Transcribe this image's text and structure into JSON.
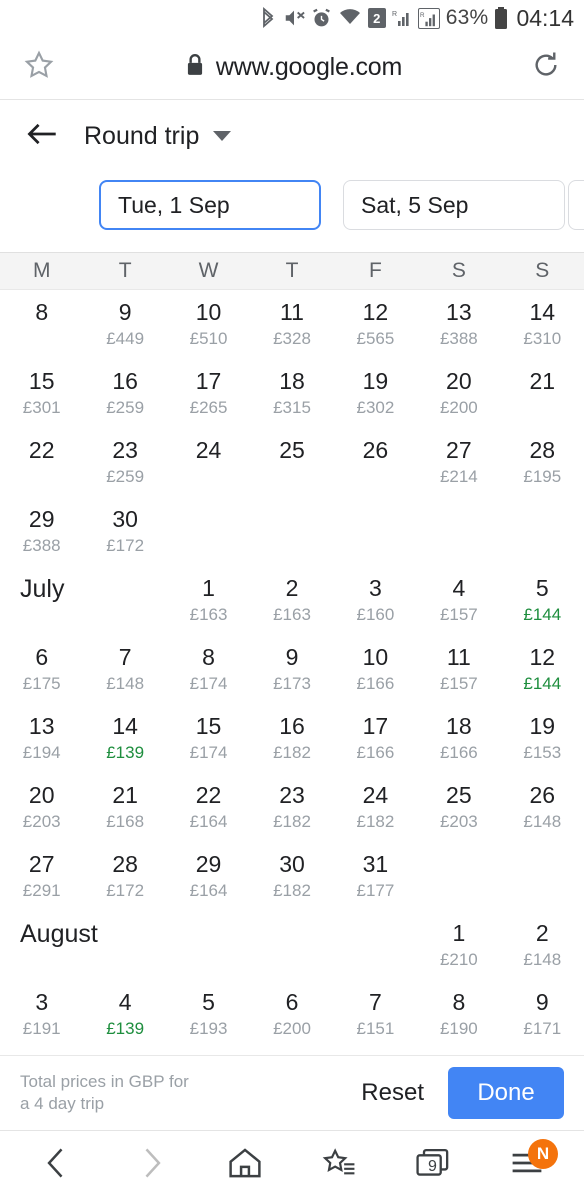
{
  "status_bar": {
    "icons": [
      "bluetooth-icon",
      "mute-icon",
      "alarm-icon",
      "wifi-icon",
      "sim-2-icon",
      "signal-roaming-icon",
      "signal-roaming-boxed-icon"
    ],
    "battery_percent": "63%",
    "battery_icon": "battery-icon",
    "time": "04:14"
  },
  "browser": {
    "bookmark_icon": "star-outline-icon",
    "lock_icon": "lock-icon",
    "url": "www.google.com",
    "reload_icon": "reload-icon"
  },
  "toolbar": {
    "back_icon": "arrow-left-icon",
    "trip_type": "Round trip",
    "dropdown_icon": "caret-down-icon"
  },
  "date_fields": [
    {
      "name": "departure-date-field",
      "value": "Tue, 1 Sep",
      "focused": true
    },
    {
      "name": "return-date-field",
      "value": "Sat, 5 Sep",
      "focused": false
    },
    {
      "name": "third-field-partial",
      "value": "",
      "focused": false
    }
  ],
  "calendar": {
    "weekday_headers": [
      "M",
      "T",
      "W",
      "T",
      "F",
      "S",
      "S"
    ],
    "currency_symbol": "£",
    "cheap_color": "#1e8e3e",
    "price_color": "#9aa0a6",
    "weeks": [
      {
        "month_label": "",
        "days": [
          {
            "day": "8",
            "price": ""
          },
          {
            "day": "9",
            "price": "£449"
          },
          {
            "day": "10",
            "price": "£510"
          },
          {
            "day": "11",
            "price": "£328"
          },
          {
            "day": "12",
            "price": "£565"
          },
          {
            "day": "13",
            "price": "£388"
          },
          {
            "day": "14",
            "price": "£310"
          }
        ]
      },
      {
        "month_label": "",
        "days": [
          {
            "day": "15",
            "price": "£301"
          },
          {
            "day": "16",
            "price": "£259"
          },
          {
            "day": "17",
            "price": "£265"
          },
          {
            "day": "18",
            "price": "£315"
          },
          {
            "day": "19",
            "price": "£302"
          },
          {
            "day": "20",
            "price": "£200"
          },
          {
            "day": "21",
            "price": ""
          }
        ]
      },
      {
        "month_label": "",
        "days": [
          {
            "day": "22",
            "price": ""
          },
          {
            "day": "23",
            "price": "£259"
          },
          {
            "day": "24",
            "price": ""
          },
          {
            "day": "25",
            "price": ""
          },
          {
            "day": "26",
            "price": ""
          },
          {
            "day": "27",
            "price": "£214"
          },
          {
            "day": "28",
            "price": "£195"
          }
        ]
      },
      {
        "month_label": "",
        "days": [
          {
            "day": "29",
            "price": "£388"
          },
          {
            "day": "30",
            "price": "£172"
          },
          {
            "day": "",
            "price": ""
          },
          {
            "day": "",
            "price": ""
          },
          {
            "day": "",
            "price": ""
          },
          {
            "day": "",
            "price": ""
          },
          {
            "day": "",
            "price": ""
          }
        ]
      },
      {
        "month_label": "July",
        "days": [
          {
            "day": "",
            "price": ""
          },
          {
            "day": "",
            "price": ""
          },
          {
            "day": "1",
            "price": "£163"
          },
          {
            "day": "2",
            "price": "£163"
          },
          {
            "day": "3",
            "price": "£160"
          },
          {
            "day": "4",
            "price": "£157"
          },
          {
            "day": "5",
            "price": "£144",
            "cheap": true
          }
        ]
      },
      {
        "month_label": "",
        "days": [
          {
            "day": "6",
            "price": "£175"
          },
          {
            "day": "7",
            "price": "£148"
          },
          {
            "day": "8",
            "price": "£174"
          },
          {
            "day": "9",
            "price": "£173"
          },
          {
            "day": "10",
            "price": "£166"
          },
          {
            "day": "11",
            "price": "£157"
          },
          {
            "day": "12",
            "price": "£144",
            "cheap": true
          }
        ]
      },
      {
        "month_label": "",
        "days": [
          {
            "day": "13",
            "price": "£194"
          },
          {
            "day": "14",
            "price": "£139",
            "cheap": true
          },
          {
            "day": "15",
            "price": "£174"
          },
          {
            "day": "16",
            "price": "£182"
          },
          {
            "day": "17",
            "price": "£166"
          },
          {
            "day": "18",
            "price": "£166"
          },
          {
            "day": "19",
            "price": "£153"
          }
        ]
      },
      {
        "month_label": "",
        "days": [
          {
            "day": "20",
            "price": "£203"
          },
          {
            "day": "21",
            "price": "£168"
          },
          {
            "day": "22",
            "price": "£164"
          },
          {
            "day": "23",
            "price": "£182"
          },
          {
            "day": "24",
            "price": "£182"
          },
          {
            "day": "25",
            "price": "£203"
          },
          {
            "day": "26",
            "price": "£148"
          }
        ]
      },
      {
        "month_label": "",
        "days": [
          {
            "day": "27",
            "price": "£291"
          },
          {
            "day": "28",
            "price": "£172"
          },
          {
            "day": "29",
            "price": "£164"
          },
          {
            "day": "30",
            "price": "£182"
          },
          {
            "day": "31",
            "price": "£177"
          },
          {
            "day": "",
            "price": ""
          },
          {
            "day": "",
            "price": ""
          }
        ]
      },
      {
        "month_label": "August",
        "days": [
          {
            "day": "",
            "price": ""
          },
          {
            "day": "",
            "price": ""
          },
          {
            "day": "",
            "price": ""
          },
          {
            "day": "",
            "price": ""
          },
          {
            "day": "",
            "price": ""
          },
          {
            "day": "1",
            "price": "£210"
          },
          {
            "day": "2",
            "price": "£148"
          }
        ]
      },
      {
        "month_label": "",
        "days": [
          {
            "day": "3",
            "price": "£191"
          },
          {
            "day": "4",
            "price": "£139",
            "cheap": true
          },
          {
            "day": "5",
            "price": "£193"
          },
          {
            "day": "6",
            "price": "£200"
          },
          {
            "day": "7",
            "price": "£151"
          },
          {
            "day": "8",
            "price": "£190"
          },
          {
            "day": "9",
            "price": "£171"
          }
        ]
      }
    ]
  },
  "footer": {
    "note_line1": "Total prices in GBP for",
    "note_line2": "a 4 day trip",
    "reset_label": "Reset",
    "done_label": "Done",
    "done_color": "#4285f4"
  },
  "bottom_nav": {
    "back_icon": "chevron-left-icon",
    "forward_icon": "chevron-right-icon",
    "home_icon": "home-icon",
    "bookmarks_icon": "star-list-icon",
    "tabs_icon": "tabs-icon",
    "tabs_count": "9",
    "menu_icon": "menu-icon",
    "menu_badge": "N",
    "badge_color": "#f4730c"
  }
}
